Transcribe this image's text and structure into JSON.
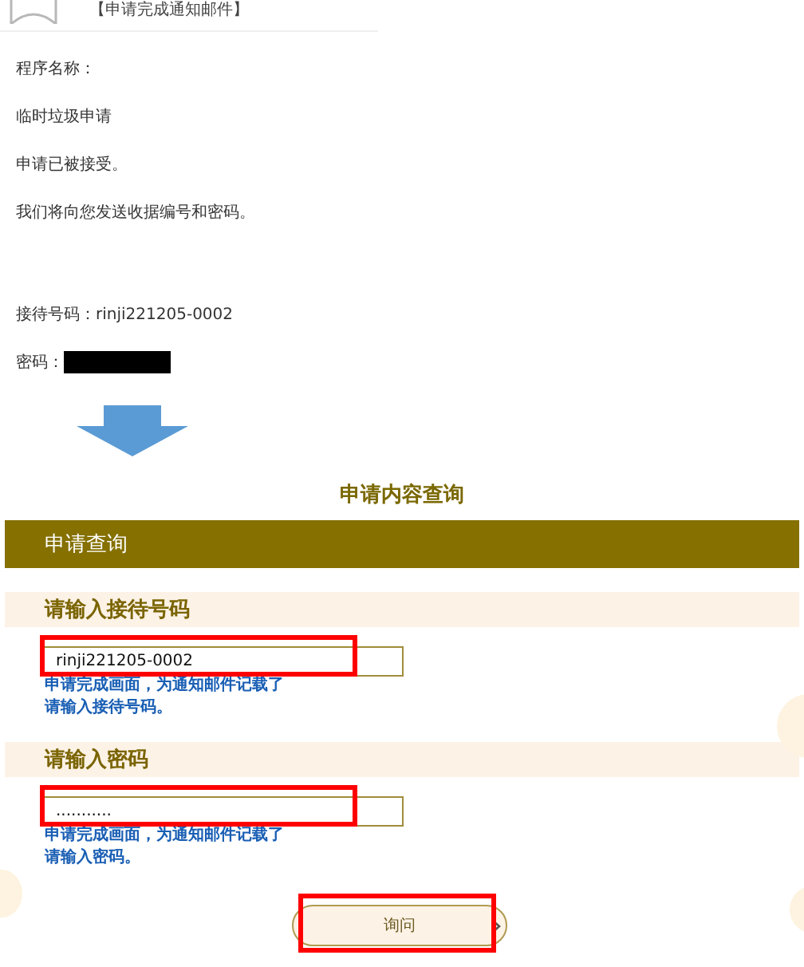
{
  "email": {
    "title": "【申请完成通知邮件】",
    "lines": [
      "程序名称：",
      "临时垃圾申请",
      "申请已被接受。",
      "我们将向您发送收据编号和密码。"
    ],
    "reception": "接待号码：rinji221205-0002",
    "password_label": "密码："
  },
  "inquiry": {
    "heading": "申请内容查询",
    "bar_title": "申请查询",
    "fields": [
      {
        "label": "请输入接待号码",
        "value": "rinji221205-0002",
        "hint": [
          "申请完成画面，为通知邮件记载了",
          "请输入接待号码。"
        ]
      },
      {
        "label": "请输入密码",
        "value": "...........",
        "hint": [
          "申请完成画面，为通知邮件记载了",
          "请输入密码。"
        ]
      }
    ],
    "button": "询问"
  }
}
